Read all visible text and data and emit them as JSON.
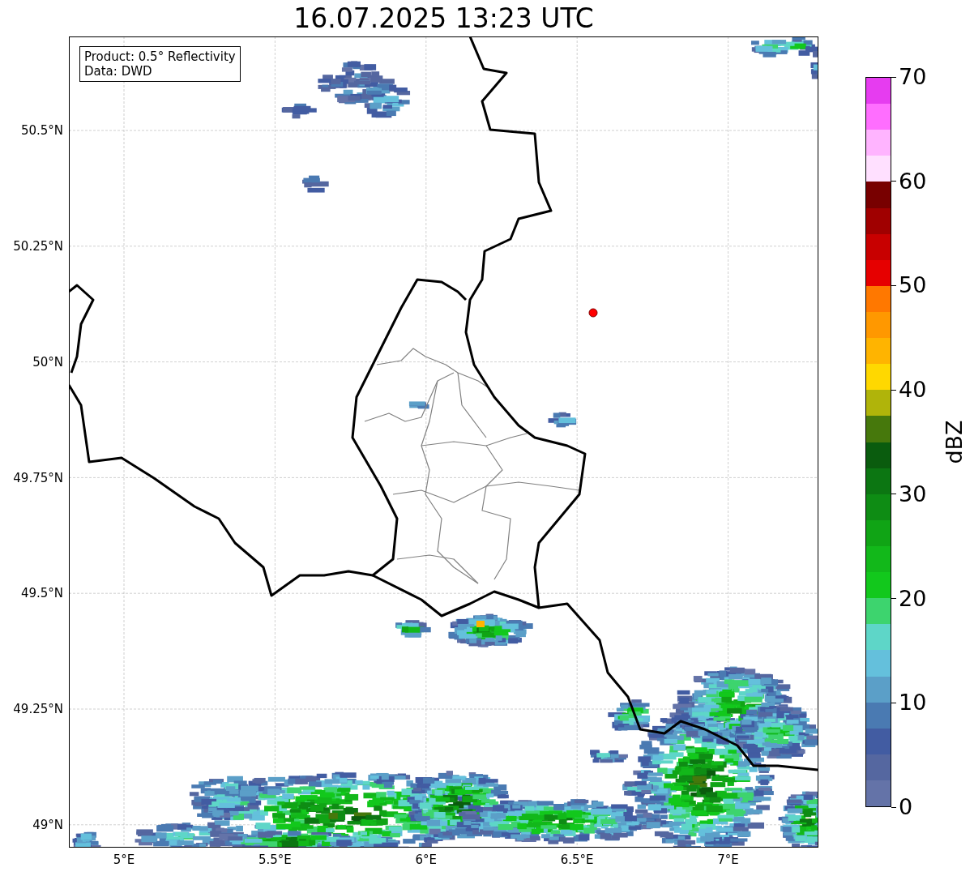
{
  "title": "16.07.2025 13:23 UTC",
  "legend": [
    "Product: 0.5° Reflectivity",
    "Data: DWD"
  ],
  "lat_labels": [
    "50.5°N",
    "50.25°N",
    "50°N",
    "49.75°N",
    "49.5°N",
    "49.25°N",
    "49°N"
  ],
  "lon_labels": [
    "5°E",
    "5.5°E",
    "6°E",
    "6.5°E",
    "7°E"
  ],
  "colorbar": {
    "label": "dBZ",
    "ticks": [
      "70",
      "60",
      "50",
      "40",
      "30",
      "20",
      "10",
      "0"
    ]
  }
}
